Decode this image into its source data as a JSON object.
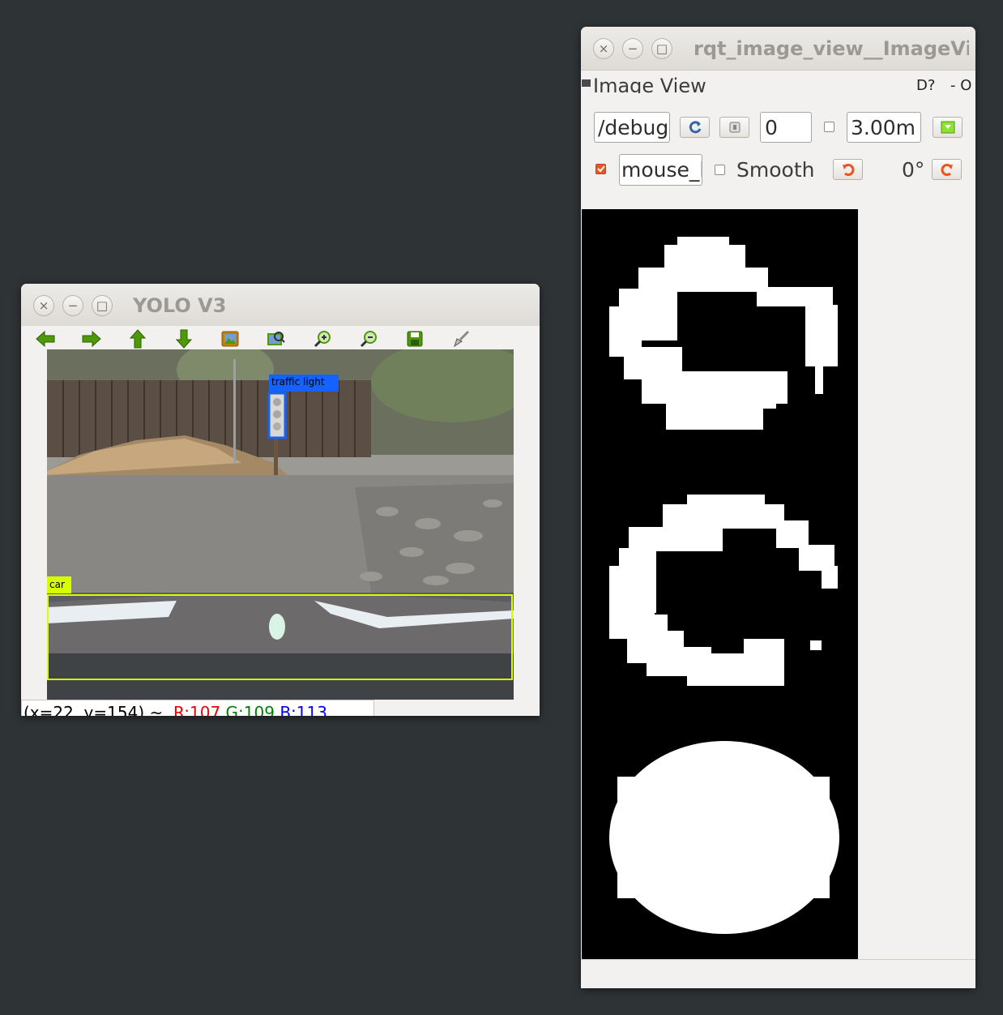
{
  "yolo_window": {
    "title": "YOLO V3",
    "controls": {
      "close": "×",
      "minimize": "−",
      "maximize": "□"
    },
    "toolbar": [
      {
        "name": "back-arrow-icon",
        "color": "#4e9a06"
      },
      {
        "name": "forward-arrow-icon",
        "color": "#4e9a06"
      },
      {
        "name": "up-arrow-icon",
        "color": "#4e9a06"
      },
      {
        "name": "down-arrow-icon",
        "color": "#4e9a06"
      },
      {
        "name": "image-icon",
        "color": "#8f5902"
      },
      {
        "name": "zoom-fit-icon",
        "color": "#4e9a06"
      },
      {
        "name": "zoom-in-icon",
        "color": "#4e9a06"
      },
      {
        "name": "zoom-out-icon",
        "color": "#4e9a06"
      },
      {
        "name": "save-icon",
        "color": "#4e9a06"
      },
      {
        "name": "brush-icon",
        "color": "#888a85"
      }
    ],
    "detections": [
      {
        "label": "traffic light",
        "color": "#1462ff"
      },
      {
        "label": "car",
        "color": "#d8ff00"
      }
    ],
    "status": {
      "coords": "(x=22, y=154) ~",
      "r": "R:107",
      "g": "G:109",
      "b": "B:113",
      "r_color": "#ef0000",
      "g_color": "#008000",
      "b_color": "#0000ff"
    }
  },
  "rqt_window": {
    "title": "rqt_image_view__ImageView",
    "controls": {
      "close": "×",
      "minimize": "−",
      "maximize": "□"
    },
    "dock_title": "Image View",
    "dock_buttons": "D?",
    "dock_close": "- O",
    "topic_value": "/debug",
    "refresh_icon": "refresh-icon",
    "stop_value": "0",
    "timeout_checked": false,
    "timeout_value": "3.00m",
    "mouse_checked": true,
    "mouse_topic_value": "mouse_left",
    "smooth_checked": false,
    "smooth_label": "Smooth",
    "rotation_label": "0°",
    "accent_color": "#e95420"
  }
}
